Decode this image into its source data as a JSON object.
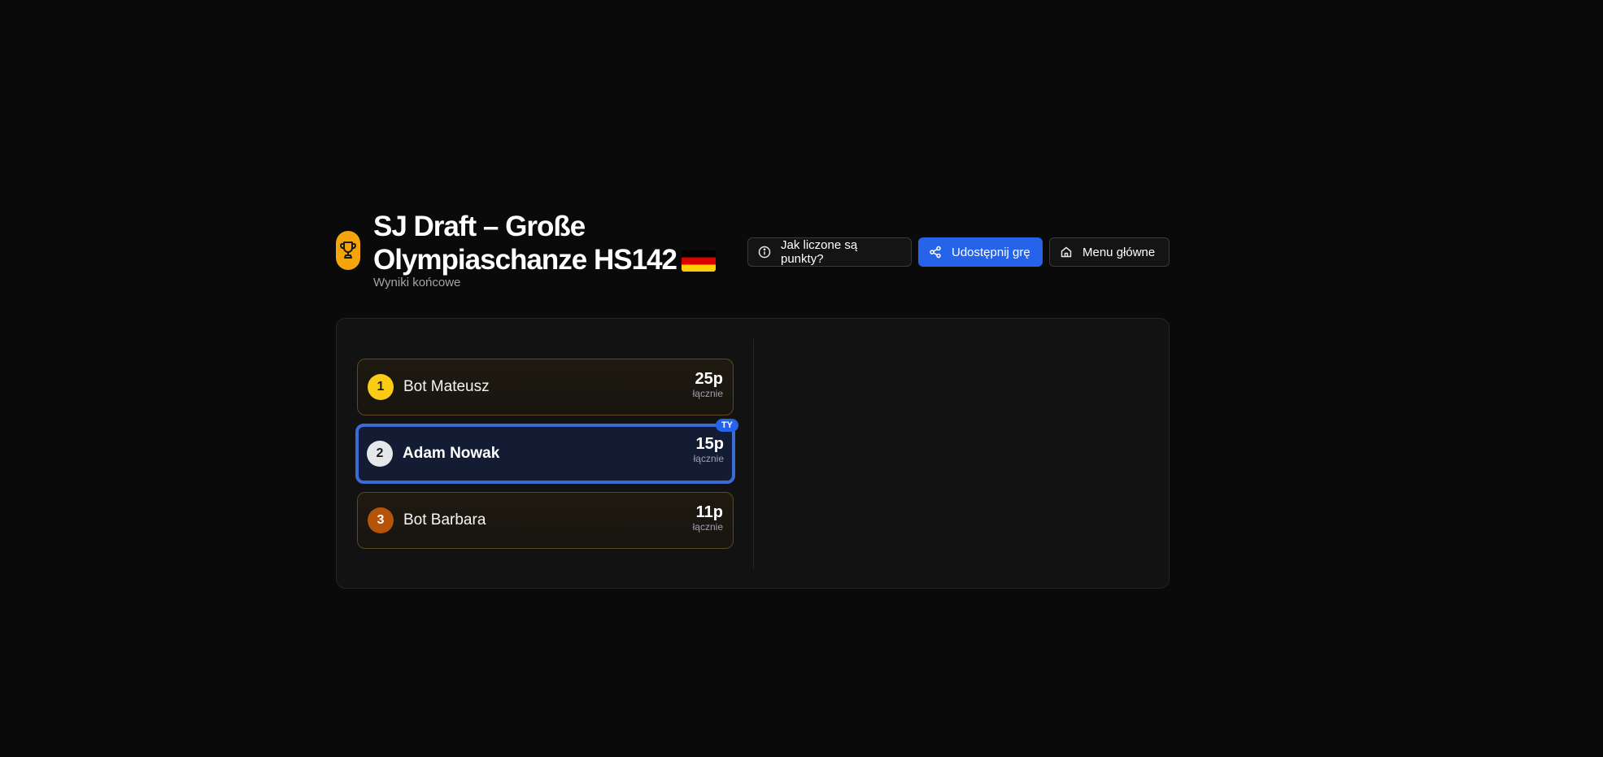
{
  "header": {
    "title": "SJ Draft – Große Olympiaschanze HS142",
    "flag_icon": "germany-flag-icon",
    "subtitle": "Wyniki końcowe",
    "trophy_icon": "trophy-icon",
    "accent_color": "#f5a40c"
  },
  "actions": {
    "info_label": "Jak liczone są punkty?",
    "share_label": "Udostępnij grę",
    "home_label": "Menu główne",
    "share_color": "#2563eb"
  },
  "results": {
    "points_caption": "łącznie",
    "you_badge": "TY",
    "players": [
      {
        "rank": "1",
        "name": "Bot Mateusz",
        "points": "25p"
      },
      {
        "rank": "2",
        "name": "Adam Nowak",
        "points": "15p"
      },
      {
        "rank": "3",
        "name": "Bot Barbara",
        "points": "11p"
      }
    ]
  }
}
